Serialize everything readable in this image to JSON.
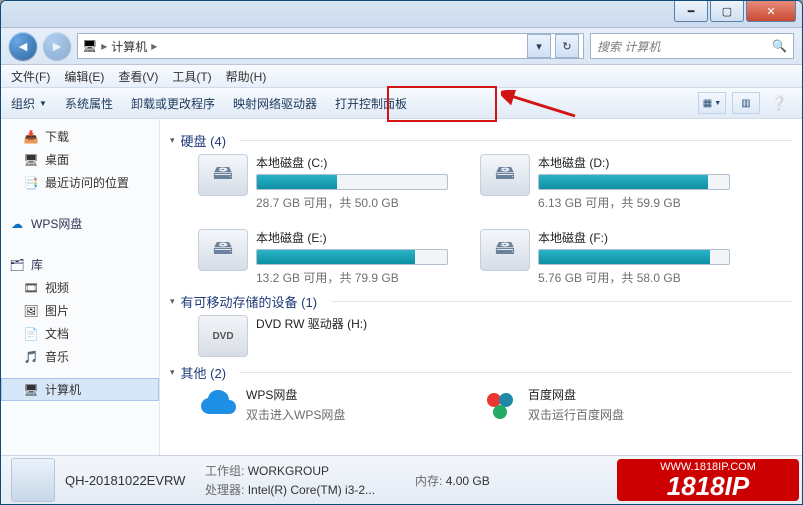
{
  "titlebar": {
    "min": "━",
    "max": "▢",
    "close": "✕"
  },
  "address": {
    "root": "计算机",
    "search_placeholder": "搜索 计算机"
  },
  "menu": {
    "file": "文件(F)",
    "edit": "编辑(E)",
    "view": "查看(V)",
    "tools": "工具(T)",
    "help": "帮助(H)"
  },
  "toolbar": {
    "org": "组织",
    "sys": "系统属性",
    "uninstall": "卸载或更改程序",
    "map": "映射网络驱动器",
    "panel": "打开控制面板"
  },
  "sidebar": {
    "downloads": "下载",
    "desktop": "桌面",
    "recent": "最近访问的位置",
    "wps": "WPS网盘",
    "lib_label": "库",
    "video": "视频",
    "picture": "图片",
    "doc": "文档",
    "music": "音乐",
    "computer": "计算机"
  },
  "groups": {
    "hdd": "硬盘 (4)",
    "removable": "有可移动存储的设备 (1)",
    "other": "其他 (2)"
  },
  "drives": {
    "c": {
      "name": "本地磁盘 (C:)",
      "sub": "28.7 GB 可用，共 50.0 GB",
      "fill": 42
    },
    "d": {
      "name": "本地磁盘 (D:)",
      "sub": "6.13 GB 可用，共 59.9 GB",
      "fill": 89
    },
    "e": {
      "name": "本地磁盘 (E:)",
      "sub": "13.2 GB 可用，共 79.9 GB",
      "fill": 83
    },
    "f": {
      "name": "本地磁盘 (F:)",
      "sub": "5.76 GB 可用，共 58.0 GB",
      "fill": 90
    },
    "dvd": {
      "name": "DVD RW 驱动器 (H:)"
    },
    "wps": {
      "name": "WPS网盘",
      "sub": "双击进入WPS网盘"
    },
    "baidu": {
      "name": "百度网盘",
      "sub": "双击运行百度网盘"
    }
  },
  "footer": {
    "name": "QH-20181022EVRW",
    "group_label": "工作组:",
    "group": "WORKGROUP",
    "mem_label": "内存:",
    "mem": "4.00 GB",
    "cpu_label": "处理器:",
    "cpu": "Intel(R) Core(TM) i3-2..."
  },
  "watermark": {
    "url": "WWW.1818IP.COM",
    "brand": "1818IP"
  }
}
